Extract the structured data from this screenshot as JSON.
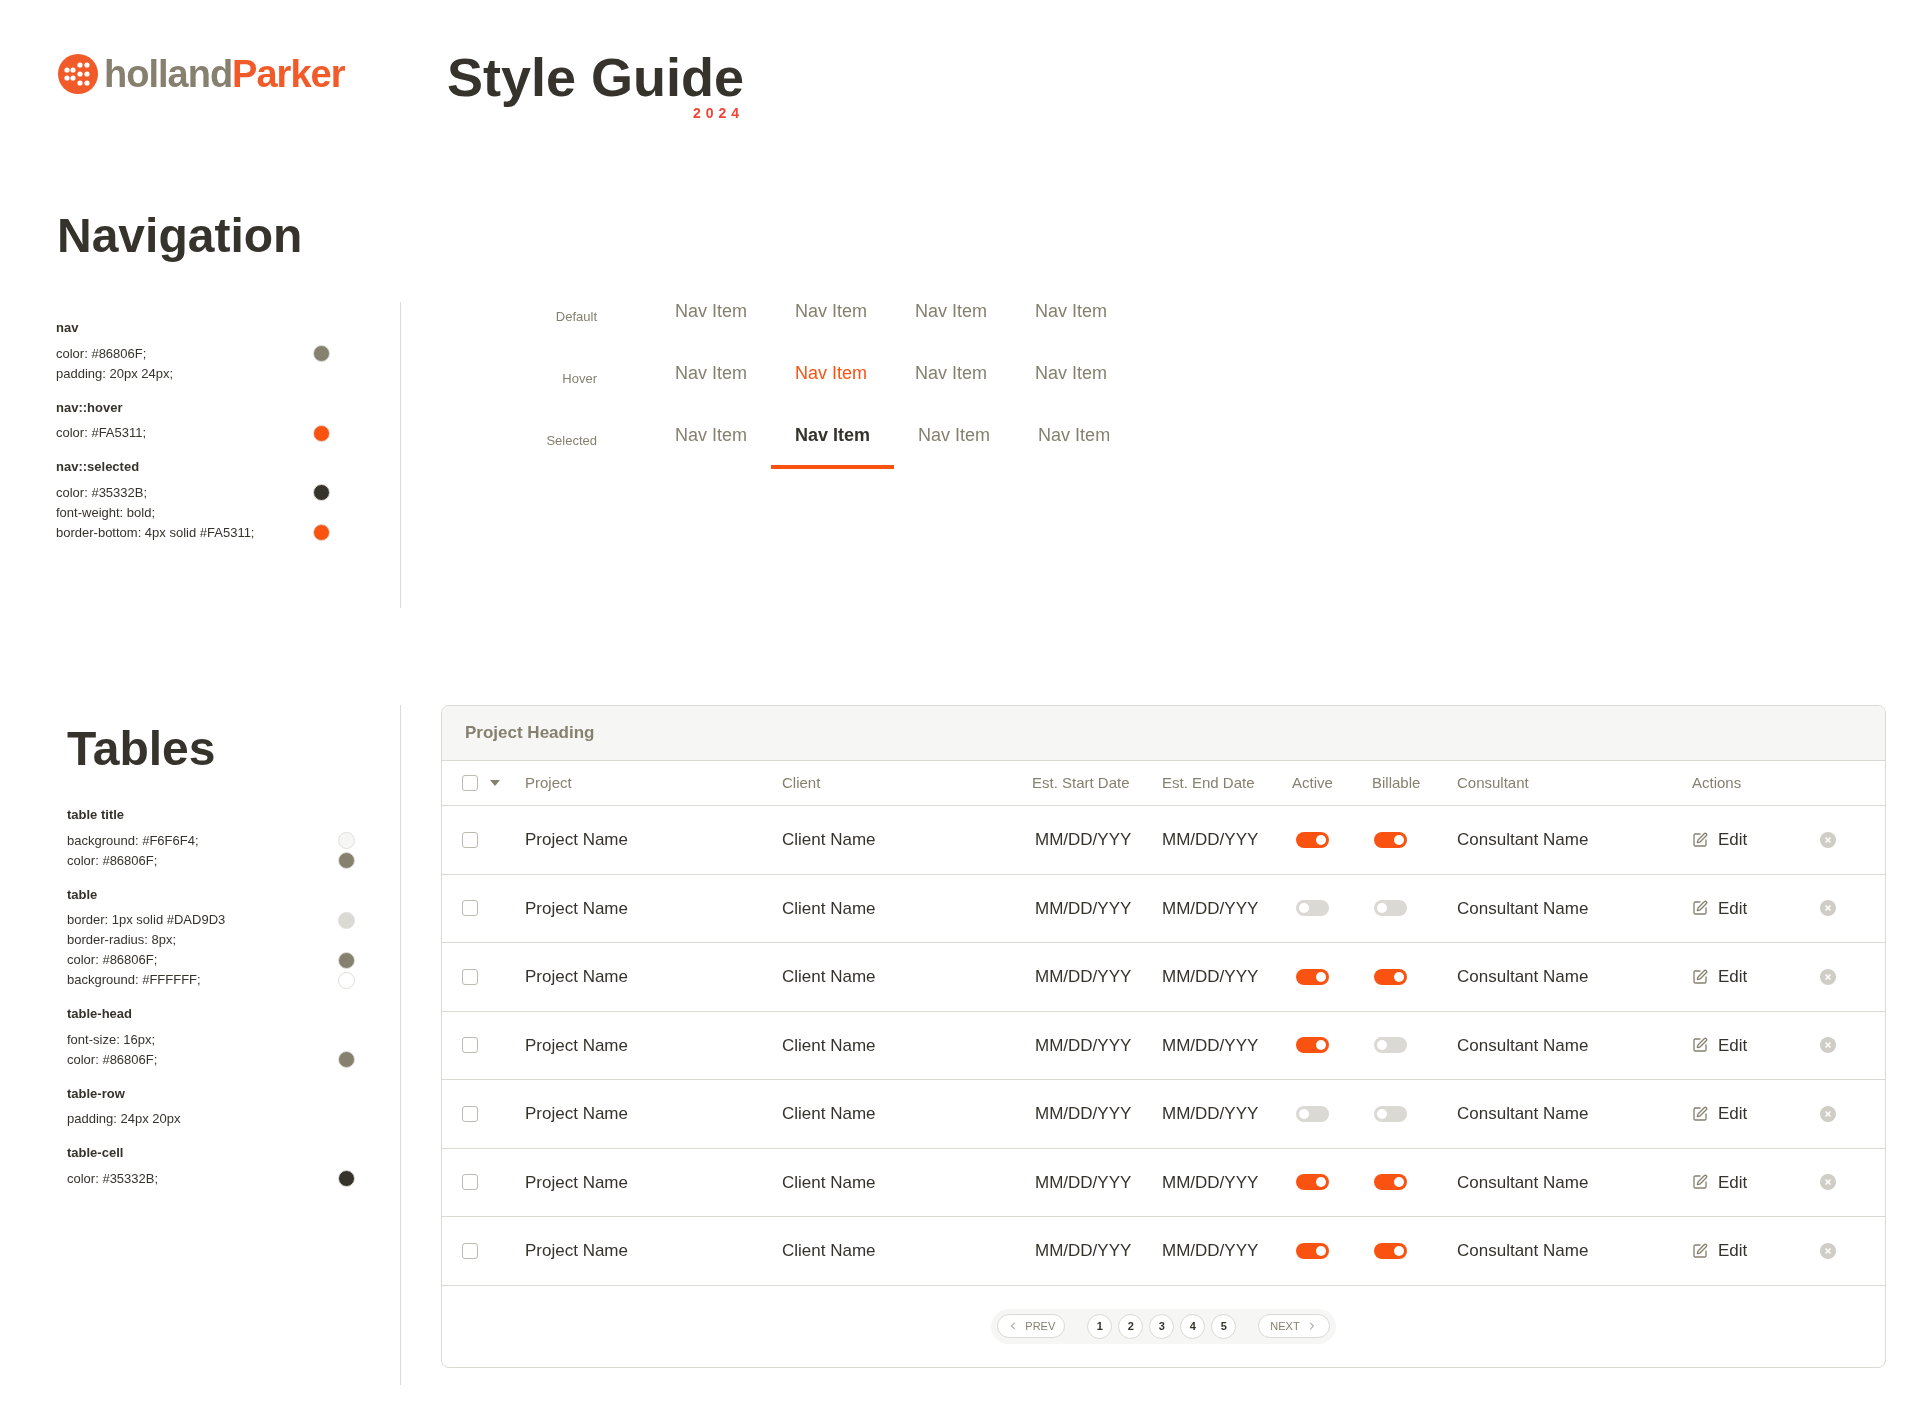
{
  "brand": {
    "first": "holland",
    "second": "Parker"
  },
  "title": {
    "text": "Style Guide",
    "year": "2024"
  },
  "navigation": {
    "heading": "Navigation",
    "spec": [
      {
        "title": "nav",
        "lines": [
          {
            "text": "color: #86806F;",
            "color": "#86806f"
          },
          {
            "text": "padding: 20px 24px;"
          }
        ]
      },
      {
        "title": "nav::hover",
        "lines": [
          {
            "text": "color: #FA5311;",
            "color": "#fa5311"
          }
        ]
      },
      {
        "title": "nav::selected",
        "lines": [
          {
            "text": "color: #35332B;",
            "color": "#35332b"
          },
          {
            "text": "font-weight: bold;"
          },
          {
            "text": "border-bottom: 4px solid #FA5311;",
            "color": "#fa5311"
          }
        ]
      }
    ],
    "demo": [
      {
        "label": "Default",
        "items": [
          {
            "label": "Nav Item",
            "hovered": false,
            "selected": false
          },
          {
            "label": "Nav Item",
            "hovered": false,
            "selected": false
          },
          {
            "label": "Nav Item",
            "hovered": false,
            "selected": false
          },
          {
            "label": "Nav Item",
            "hovered": false,
            "selected": false
          }
        ]
      },
      {
        "label": "Hover",
        "items": [
          {
            "label": "Nav Item",
            "hovered": false,
            "selected": false
          },
          {
            "label": "Nav Item",
            "hovered": true,
            "selected": false
          },
          {
            "label": "Nav Item",
            "hovered": false,
            "selected": false
          },
          {
            "label": "Nav Item",
            "hovered": false,
            "selected": false
          }
        ]
      },
      {
        "label": "Selected",
        "items": [
          {
            "label": "Nav Item",
            "hovered": false,
            "selected": false
          },
          {
            "label": "Nav Item",
            "hovered": false,
            "selected": true
          },
          {
            "label": "Nav Item",
            "hovered": false,
            "selected": false
          },
          {
            "label": "Nav Item",
            "hovered": false,
            "selected": false
          }
        ]
      }
    ]
  },
  "tables": {
    "heading": "Tables",
    "spec": [
      {
        "title": "table title",
        "lines": [
          {
            "text": "background: #F6F6F4;",
            "color": "#f6f6f4"
          },
          {
            "text": "color: #86806F;",
            "color": "#86806f"
          }
        ]
      },
      {
        "title": "table",
        "lines": [
          {
            "text": "border: 1px solid #DAD9D3",
            "color": "#dad9d3"
          },
          {
            "text": "border-radius:  8px;"
          },
          {
            "text": "color: #86806F;",
            "color": "#86806f"
          },
          {
            "text": "background: #FFFFFF;",
            "color": "#ffffff"
          }
        ]
      },
      {
        "title": "table-head",
        "lines": [
          {
            "text": "font-size: 16px;"
          },
          {
            "text": "color: #86806F;",
            "color": "#86806f"
          }
        ]
      },
      {
        "title": "table-row",
        "lines": [
          {
            "text": "padding: 24px 20px"
          }
        ]
      },
      {
        "title": "table-cell",
        "lines": [
          {
            "text": "color: #35332B;",
            "color": "#35332b"
          }
        ]
      }
    ],
    "table": {
      "title": "Project Heading",
      "select_all_checked": false,
      "columns": [
        "Project",
        "Client",
        "Est. Start Date",
        "Est. End Date",
        "Active",
        "Billable",
        "Consultant",
        "Actions"
      ],
      "rows": [
        {
          "checked": false,
          "project": "Project Name",
          "client": "Client Name",
          "start": "MM/DD/YYY",
          "end": "MM/DD/YYY",
          "active": true,
          "billable": true,
          "consultant": "Consultant Name",
          "action": "Edit"
        },
        {
          "checked": false,
          "project": "Project Name",
          "client": "Client Name",
          "start": "MM/DD/YYY",
          "end": "MM/DD/YYY",
          "active": false,
          "billable": false,
          "consultant": "Consultant Name",
          "action": "Edit"
        },
        {
          "checked": false,
          "project": "Project Name",
          "client": "Client Name",
          "start": "MM/DD/YYY",
          "end": "MM/DD/YYY",
          "active": true,
          "billable": true,
          "consultant": "Consultant Name",
          "action": "Edit"
        },
        {
          "checked": false,
          "project": "Project Name",
          "client": "Client Name",
          "start": "MM/DD/YYY",
          "end": "MM/DD/YYY",
          "active": true,
          "billable": false,
          "consultant": "Consultant Name",
          "action": "Edit"
        },
        {
          "checked": false,
          "project": "Project Name",
          "client": "Client Name",
          "start": "MM/DD/YYY",
          "end": "MM/DD/YYY",
          "active": false,
          "billable": false,
          "consultant": "Consultant Name",
          "action": "Edit"
        },
        {
          "checked": false,
          "project": "Project Name",
          "client": "Client Name",
          "start": "MM/DD/YYY",
          "end": "MM/DD/YYY",
          "active": true,
          "billable": true,
          "consultant": "Consultant Name",
          "action": "Edit"
        },
        {
          "checked": false,
          "project": "Project Name",
          "client": "Client Name",
          "start": "MM/DD/YYY",
          "end": "MM/DD/YYY",
          "active": true,
          "billable": true,
          "consultant": "Consultant Name",
          "action": "Edit"
        }
      ],
      "pagination": {
        "prev": "PREV",
        "pages": [
          "1",
          "2",
          "3",
          "4",
          "5"
        ],
        "next": "NEXT"
      }
    }
  }
}
